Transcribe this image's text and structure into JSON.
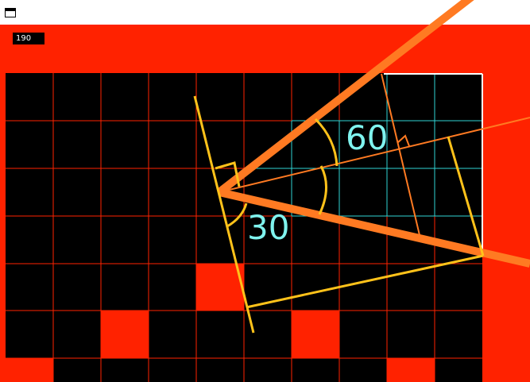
{
  "window": {
    "icon": "window-icon"
  },
  "hud": {
    "score": "190"
  },
  "diagram": {
    "angle_labels": [
      "60",
      "30"
    ]
  },
  "colors": {
    "background": "#ff2200",
    "tile_dark": "#000000",
    "grid_line": "#ff2200",
    "cyan": "#2fd5d5",
    "orange": "#ff7a22",
    "yellow": "#ffc21a",
    "label": "#7ff3ee"
  }
}
